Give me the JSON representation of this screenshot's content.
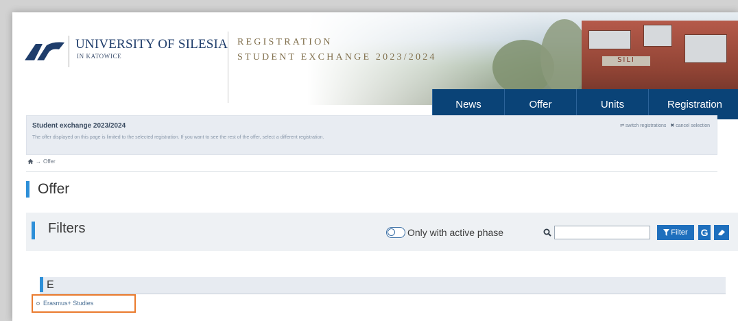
{
  "header": {
    "university_name": "UNIVERSITY OF SILESIA",
    "university_city": "IN KATOWICE",
    "registration_label": "REGISTRATION",
    "registration_subtitle": "STUDENT EXCHANGE 2023/2024",
    "building_sign": "SILI",
    "logo_icon": "us-logo-icon"
  },
  "nav": {
    "items": [
      {
        "label": "News"
      },
      {
        "label": "Offer"
      },
      {
        "label": "Units"
      },
      {
        "label": "Registration"
      }
    ],
    "active_color": "#0a4377"
  },
  "registration_box": {
    "title": "Student exchange 2023/2024",
    "description": "The offer displayed on this page is limited to the selected registration. If you want to see the rest of the offer, select a different registration.",
    "switch_icon": "switch-icon",
    "switch_label": "switch registrations",
    "cancel_icon": "close-icon",
    "cancel_label": "cancel selection"
  },
  "breadcrumb": {
    "home_icon": "home-icon",
    "separator": "→",
    "current": "Offer"
  },
  "page": {
    "title": "Offer",
    "accent_color": "#2d8fd8"
  },
  "filters": {
    "title": "Filters",
    "toggle_label": "Only with active phase",
    "toggle_on": false,
    "search_icon": "search-icon",
    "search_value": "",
    "filter_button_label": "Filter",
    "filter_icon": "funnel-icon",
    "g_button_label": "G",
    "clear_icon": "eraser-icon"
  },
  "listing": {
    "letter": "E",
    "items": [
      {
        "label": "Erasmus+ Studies"
      }
    ],
    "highlight_color": "#ea7a2c"
  }
}
